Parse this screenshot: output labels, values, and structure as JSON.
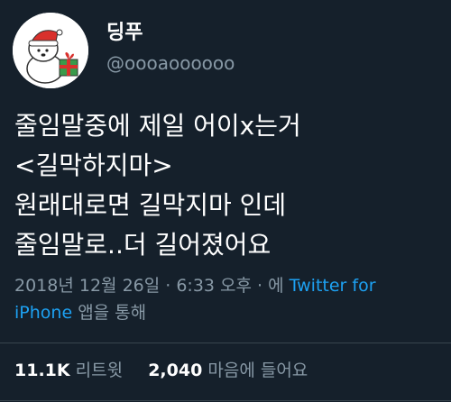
{
  "user": {
    "display_name": "딩푸",
    "handle": "@oooaoooooo",
    "avatar_icon": "polar-bear-santa-hat-avatar-icon"
  },
  "tweet": {
    "lines": [
      "줄임말중에 제일 어이x는거",
      "<길막하지마>",
      "원래대로면 길막지마 인데",
      "줄임말로..더 길어졌어요"
    ]
  },
  "meta": {
    "datetime": "2018년 12월 26일 · 6:33 오후 · 에",
    "client_part1": "Twitter for",
    "client_part2": "iPhone",
    "suffix": "앱을 통해"
  },
  "stats": {
    "retweets_count": "11.1K",
    "retweets_label": "리트윗",
    "likes_count": "2,040",
    "likes_label": "마음에 들어요"
  },
  "colors": {
    "background": "#15202b",
    "primary_text": "#ffffff",
    "secondary_text": "#8899a6",
    "link": "#1da1f2",
    "divider": "#38444d"
  }
}
